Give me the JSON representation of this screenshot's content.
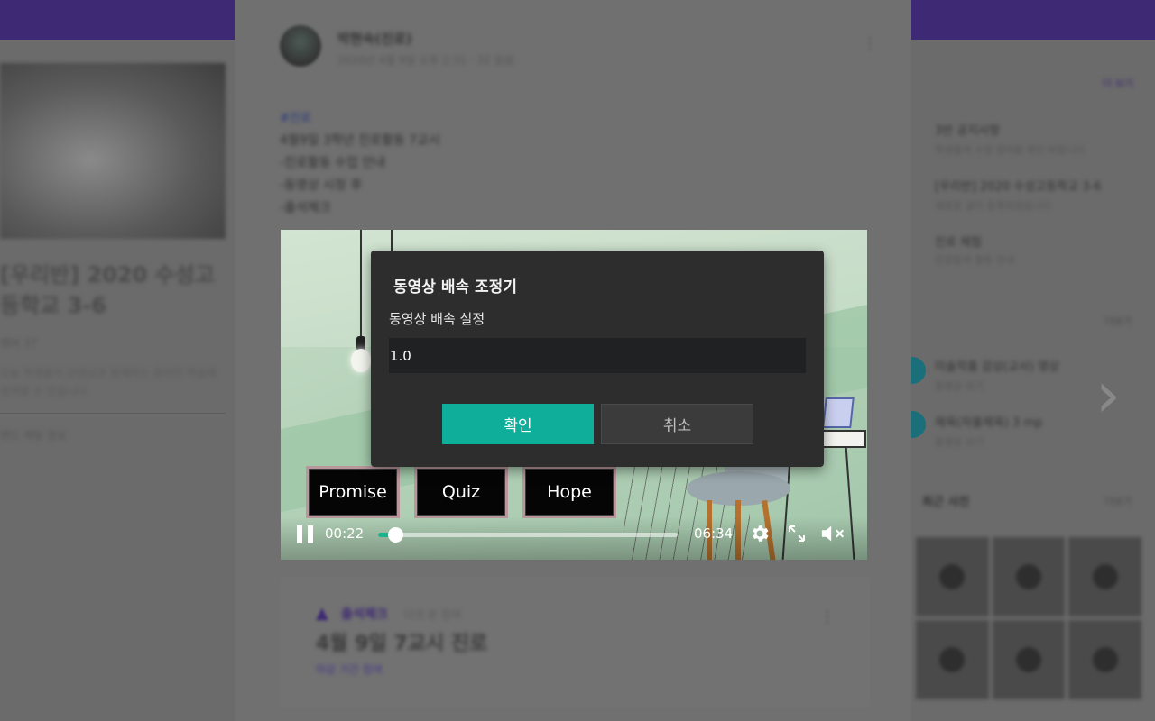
{
  "background": {
    "left_card": {
      "title": "[우리반] 2020 수성고등학교 3-6",
      "meta": "멤버 37",
      "description": "오늘 학생들이 선생님과 함께하는 온라인 학습에 참여할 수 있습니다",
      "more": "밴드 채팅 정보"
    },
    "right_panel": {
      "more_1": "더 보기",
      "items": [
        {
          "title": "3반 공지사항",
          "sub": "학생들의 수업 참여를 확인 바랍니다"
        },
        {
          "title": "[우리반] 2020 수성고등학교 3-6",
          "sub": "새로운 글이 등록되었습니다"
        },
        {
          "title": "진로 체험",
          "sub": "진로탐색 활동 안내"
        }
      ],
      "more_2": "더보기",
      "items2": [
        {
          "title": "미술작품 감상(교사) 영상",
          "sub": "동영상 보기"
        },
        {
          "title": "체육(자율체육) 3 mp",
          "sub": "동영상 보기"
        }
      ],
      "section3_title": "최근 사진",
      "more_3": "더보기"
    }
  },
  "post": {
    "author": "박현숙(진로)",
    "date": "2020년 4월 9일 오후 2:31 · 32 읽음",
    "tag": "#진로",
    "lines": [
      "4월9일 3학년 진로활동 7교시",
      "-진로활동 수업 안내",
      "-동영상 시청 후",
      "-출석체크"
    ],
    "kebab": "⋮"
  },
  "video": {
    "buttons": [
      "Promise",
      "Quiz",
      "Hope"
    ],
    "current_time": "00:22",
    "duration": "06:34",
    "progress_fraction": 0.056
  },
  "next_card": {
    "label": "출석체크",
    "sub": "다섯 분 참여",
    "title": "4월 9일 7교시 진로",
    "link": "마감 기간 참여"
  },
  "modal": {
    "title": "동영상 배속 조정기",
    "field_label": "동영상 배속 설정",
    "input_value": "1.0",
    "ok_label": "확인",
    "cancel_label": "취소"
  },
  "colors": {
    "accent": "#0fae9a",
    "brand": "#3e2a74",
    "modal_bg": "#2d2d2d"
  }
}
